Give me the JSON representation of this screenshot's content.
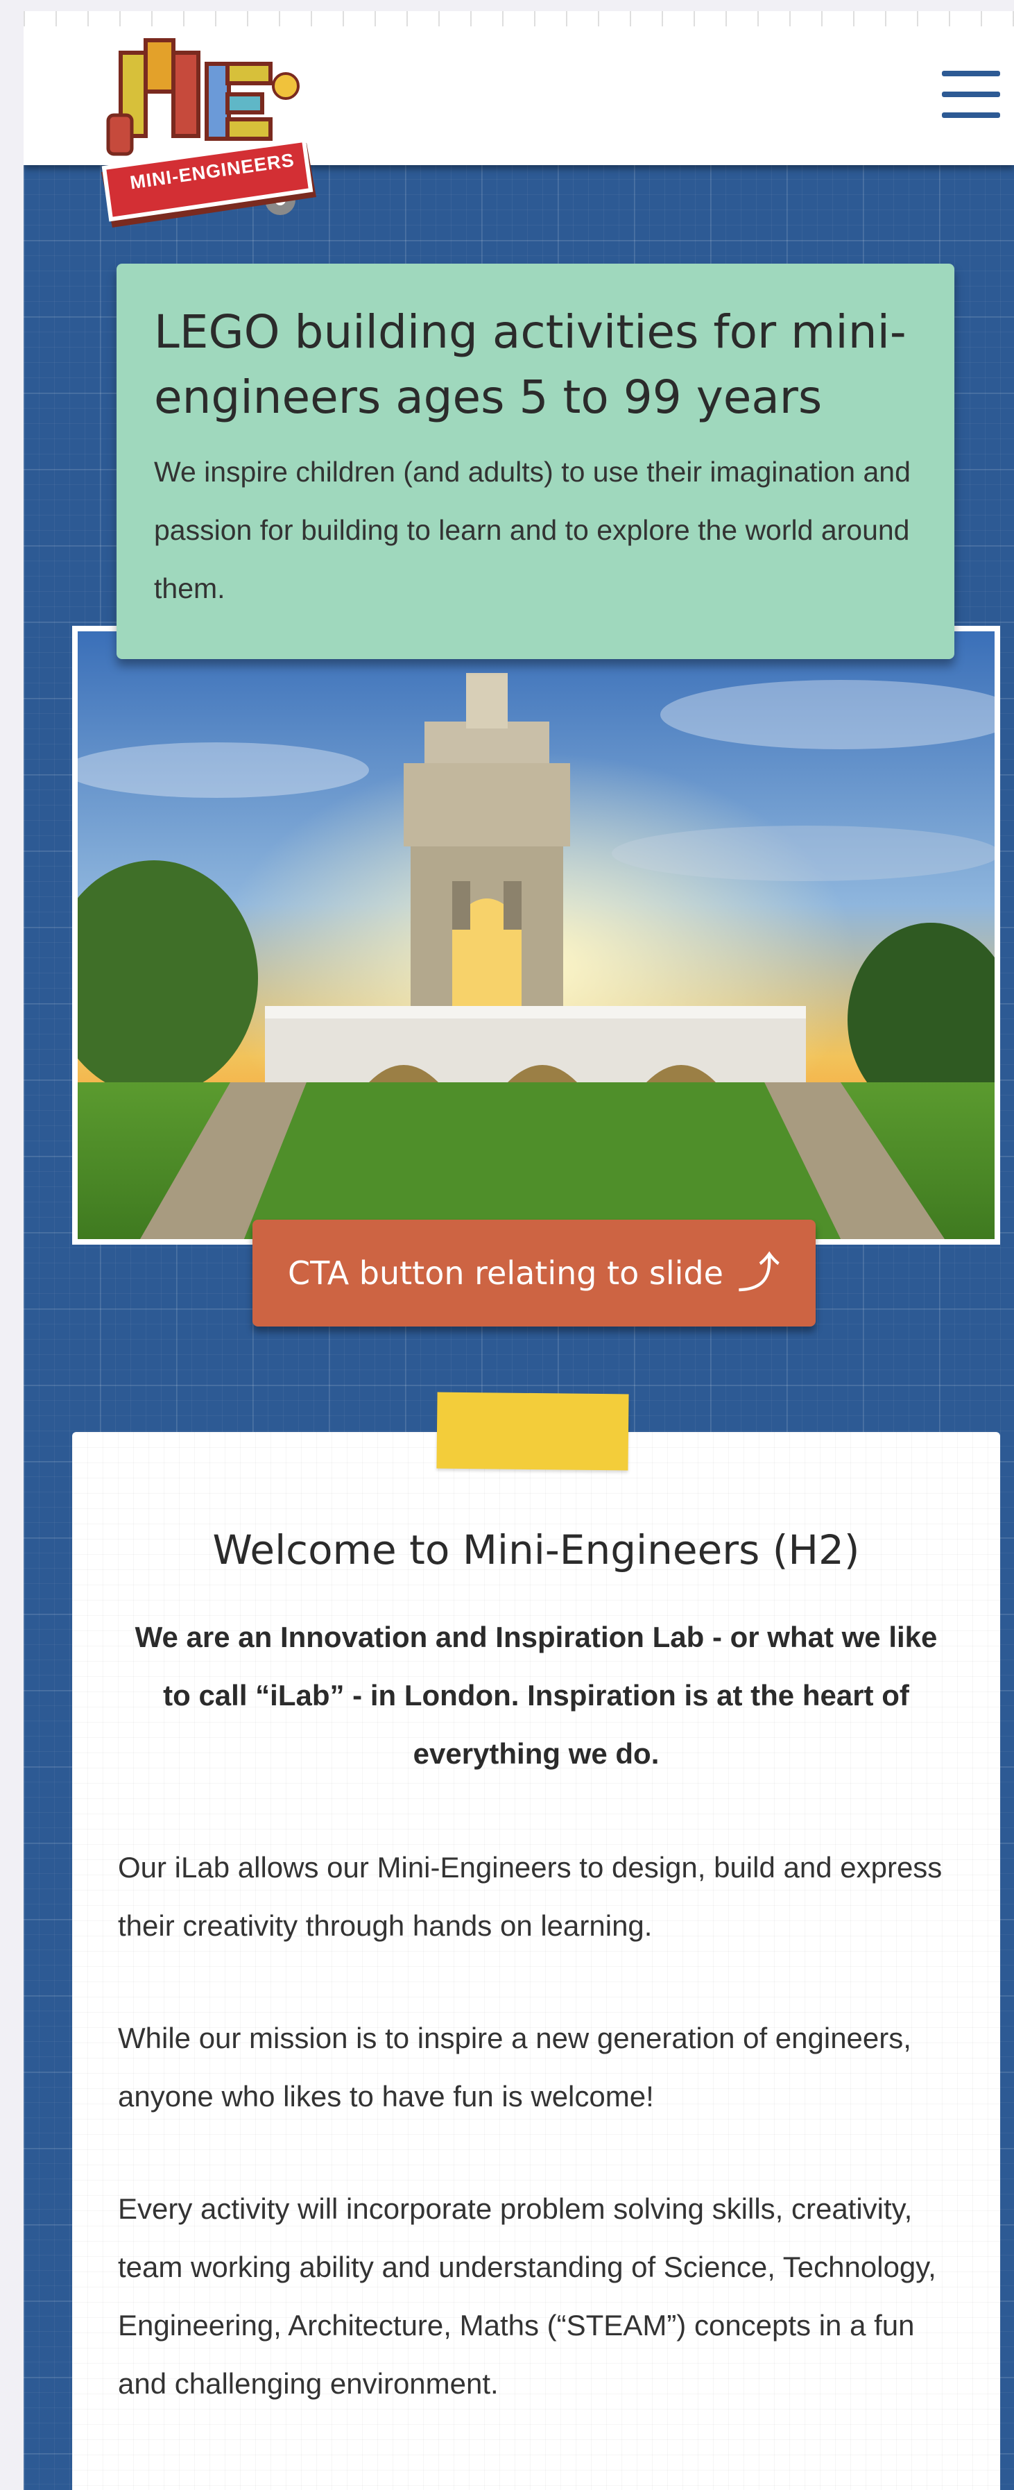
{
  "header": {
    "logo_text": "MINI-ENGINEERS",
    "menu_icon": "hamburger-menu-icon"
  },
  "hero": {
    "title": "LEGO building activities for mini-engineers ages 5 to 99 years",
    "description": "We inspire children (and adults) to use their imagination and passion for building to learn and to explore the world around them.",
    "cta_label": "CTA button relating to slide",
    "cta_icon": "curved-arrow-icon"
  },
  "welcome": {
    "title": "Welcome to Mini-Engineers (H2)",
    "lead": "We are an Innovation and Inspiration Lab - or what we like to call “iLab” - in London.  Inspiration is at the heart of everything we do.",
    "paragraphs": [
      "Our iLab allows our Mini-Engineers to design, build and express their creativity through hands on learning.",
      "While our mission is to inspire a new generation of engineers, anyone who likes to have fun is welcome!",
      "Every activity will incorporate problem solving skills, creativity, team working ability and understanding of Science, Technology, Engineering, Architecture, Maths (“STEAM”) concepts in a fun and challenging environment."
    ]
  },
  "colors": {
    "background_blue": "#2d5a94",
    "hero_green": "#9fd8bd",
    "cta_orange": "#cd6443",
    "logo_red": "#d32f34",
    "tape_yellow": "#f3cd3a"
  }
}
